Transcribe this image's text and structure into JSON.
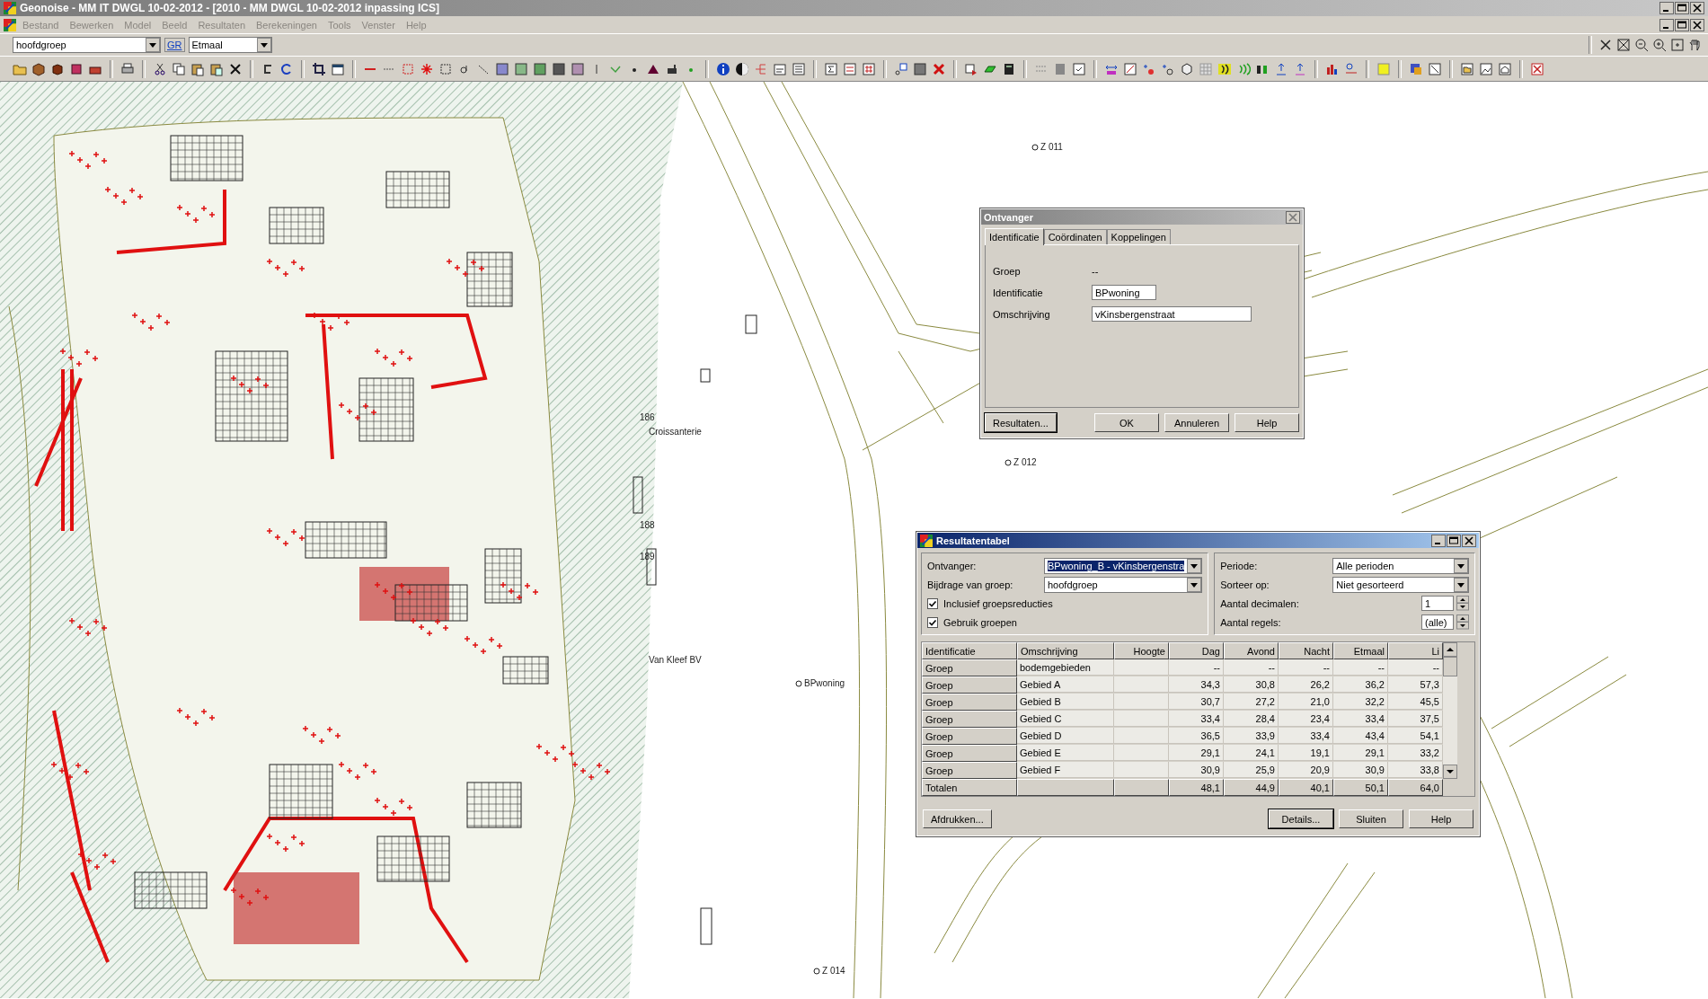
{
  "window": {
    "title": "Geonoise - MM IT DWGL 10-02-2012 - [2010 - MM DWGL 10-02-2012  inpassing ICS]"
  },
  "menu": [
    {
      "label": "Bestand",
      "disabled": true
    },
    {
      "label": "Bewerken",
      "disabled": true
    },
    {
      "label": "Model",
      "disabled": true
    },
    {
      "label": "Beeld",
      "disabled": true
    },
    {
      "label": "Resultaten",
      "disabled": true
    },
    {
      "label": "Berekeningen",
      "disabled": true
    },
    {
      "label": "Tools",
      "disabled": true
    },
    {
      "label": "Venster",
      "disabled": true
    },
    {
      "label": "Help",
      "disabled": true
    }
  ],
  "toolbar": {
    "group_select": "hoofdgroep",
    "gr_button": "GR",
    "period_select": "Etmaal"
  },
  "map": {
    "labels": [
      {
        "text": "Z 011",
        "kind": "point"
      },
      {
        "text": "Z 012",
        "kind": "point"
      },
      {
        "text": "BPwoning",
        "kind": "point"
      },
      {
        "text": "Z 014",
        "kind": "point"
      },
      {
        "text": "Croissanterie",
        "kind": "plain"
      },
      {
        "text": "Van Kleef BV",
        "kind": "plain"
      },
      {
        "text": "186",
        "kind": "plain"
      },
      {
        "text": "188",
        "kind": "plain"
      },
      {
        "text": "189",
        "kind": "plain"
      }
    ]
  },
  "ontvanger_dialog": {
    "title": "Ontvanger",
    "active": false,
    "tabs": [
      {
        "label": "Identificatie",
        "selected": true
      },
      {
        "label": "Coördinaten",
        "selected": false
      },
      {
        "label": "Koppelingen",
        "selected": false
      }
    ],
    "fields": [
      {
        "label": "Groep",
        "kind": "static",
        "value": "--"
      },
      {
        "label": "Identificatie",
        "kind": "input",
        "value": "BPwoning"
      },
      {
        "label": "Omschrijving",
        "kind": "input",
        "value": "vKinsbergenstraat"
      }
    ],
    "buttons": [
      {
        "label": "Resultaten...",
        "default": true
      },
      {
        "label": "OK",
        "default": false
      },
      {
        "label": "Annuleren",
        "default": false
      },
      {
        "label": "Help",
        "default": false
      }
    ]
  },
  "results_dialog": {
    "title": "Resultatentabel",
    "active": true,
    "left": [
      {
        "label": "Ontvanger:",
        "kind": "select",
        "value": "BPwoning_B - vKinsbergenstra",
        "selected": true
      },
      {
        "label": "Bijdrage van groep:",
        "kind": "select",
        "value": "hoofdgroep",
        "selected": false
      },
      {
        "label": "Inclusief groepsreducties",
        "kind": "checkbox",
        "checked": true
      },
      {
        "label": "Gebruik groepen",
        "kind": "checkbox",
        "checked": true
      }
    ],
    "right": [
      {
        "label": "Periode:",
        "kind": "select",
        "value": "Alle perioden"
      },
      {
        "label": "Sorteer op:",
        "kind": "select",
        "value": "Niet gesorteerd"
      },
      {
        "label": "Aantal decimalen:",
        "kind": "spinner",
        "value": "1"
      },
      {
        "label": "Aantal regels:",
        "kind": "spinner",
        "value": "(alle)"
      }
    ],
    "table": {
      "columns": [
        "Identificatie",
        "Omschrijving",
        "Hoogte",
        "Dag",
        "Avond",
        "Nacht",
        "Etmaal",
        "Li"
      ],
      "rows": [
        [
          "Groep",
          "bodemgebieden",
          null,
          "--",
          "--",
          "--",
          "--",
          "--"
        ],
        [
          "Groep",
          "Gebied A",
          null,
          "34,3",
          "30,8",
          "26,2",
          "36,2",
          "57,3"
        ],
        [
          "Groep",
          "Gebied B",
          null,
          "30,7",
          "27,2",
          "21,0",
          "32,2",
          "45,5"
        ],
        [
          "Groep",
          "Gebied C",
          null,
          "33,4",
          "28,4",
          "23,4",
          "33,4",
          "37,5"
        ],
        [
          "Groep",
          "Gebied D",
          null,
          "36,5",
          "33,9",
          "33,4",
          "43,4",
          "54,1"
        ],
        [
          "Groep",
          "Gebied E",
          null,
          "29,1",
          "24,1",
          "19,1",
          "29,1",
          "33,2"
        ],
        [
          "Groep",
          "Gebied F",
          null,
          "30,9",
          "25,9",
          "20,9",
          "30,9",
          "33,8"
        ]
      ],
      "totals": {
        "label": "Totalen",
        "values": [
          "48,1",
          "44,9",
          "40,1",
          "50,1",
          "64,0"
        ]
      }
    },
    "buttons": [
      {
        "label": "Afdrukken...",
        "default": false
      },
      {
        "label": "Details...",
        "default": true
      },
      {
        "label": "Sluiten",
        "default": false
      },
      {
        "label": "Help",
        "default": false
      }
    ]
  }
}
